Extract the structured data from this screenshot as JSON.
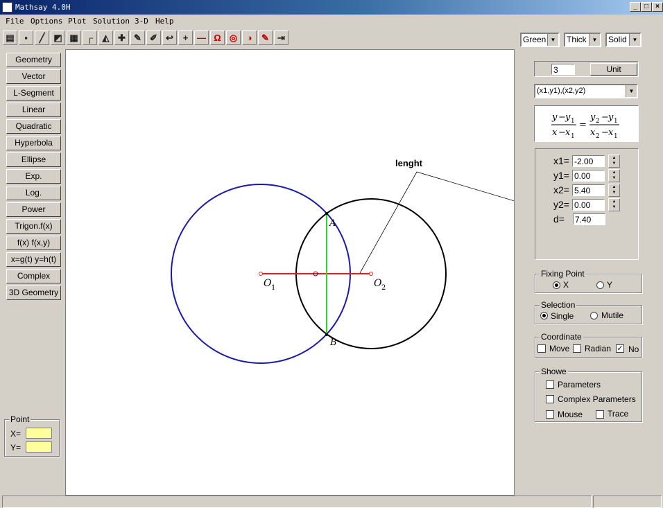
{
  "window": {
    "title": "Mathsay 4.0H",
    "minimize": "_",
    "maximize": "□",
    "close": "×"
  },
  "menu": [
    "File",
    "Options",
    "Plot",
    "Solution",
    "3-D",
    "Help"
  ],
  "toolbar": {
    "icons": [
      "print-icon",
      "save-icon",
      "pen-line-icon",
      "eraser-icon",
      "grid-icon",
      "axis-corner-icon",
      "triangle-icon",
      "crosshair-icon",
      "pencil-icon",
      "wand-icon",
      "undo-arrow-icon",
      "plus-icon",
      "minus-icon",
      "magnet-icon",
      "target-icon",
      "half-circle-icon",
      "red-pencil-icon",
      "exit-icon"
    ],
    "glyphs": [
      "▤",
      "▪",
      "╱",
      "◩",
      "▦",
      "┌",
      "◭",
      "✚",
      "✎",
      "✐",
      "↩",
      "+",
      "—",
      "Ω",
      "◎",
      "◑",
      "✎",
      "⇥"
    ],
    "color_select": "Green",
    "thickness_select": "Thick",
    "style_select": "Solid"
  },
  "left_buttons": [
    "Geometry",
    "Vector",
    "L-Segment",
    "Linear",
    "Quadratic",
    "Hyperbola",
    "Ellipse",
    "Exp.",
    "Log.",
    "Power",
    "Trigon.f(x)",
    "f(x)  f(x,y)",
    "x=g(t) y=h(t)",
    "Complex",
    "3D Geometry"
  ],
  "point": {
    "legend": "Point",
    "x_label": "X=",
    "y_label": "Y=",
    "x_value": "",
    "y_value": ""
  },
  "unit": {
    "value": "3",
    "button": "Unit"
  },
  "mode_select": "(x1,y1),(x2,y2)",
  "formula": {
    "y": "y",
    "y1": "y",
    "sub1": "1",
    "x": "x",
    "x1": "x",
    "y2": "y",
    "sub2": "2",
    "x2": "x",
    "minus": "−",
    "eq": "="
  },
  "params": [
    {
      "label": "x1=",
      "value": "-2.00"
    },
    {
      "label": "y1=",
      "value": "0.00"
    },
    {
      "label": "x2=",
      "value": "5.40"
    },
    {
      "label": "y2=",
      "value": "0.00"
    },
    {
      "label": "d=",
      "value": "7.40"
    }
  ],
  "fixing_point": {
    "legend": "Fixing Point",
    "options": [
      "X",
      "Y"
    ],
    "selected": "X"
  },
  "selection": {
    "legend": "Selection",
    "options": [
      "Single",
      "Mutile"
    ],
    "selected": "Single"
  },
  "coordinate": {
    "legend": "Coordinate",
    "items": [
      {
        "label": "Move",
        "checked": false
      },
      {
        "label": "Radian",
        "checked": false
      },
      {
        "label": "No",
        "checked": true
      }
    ]
  },
  "showe": {
    "legend": "Showe",
    "items": [
      {
        "label": "Parameters",
        "checked": false
      },
      {
        "label": "Complex Parameters",
        "checked": false
      },
      {
        "label": "Mouse",
        "checked": false
      },
      {
        "label": "Trace",
        "checked": false
      }
    ]
  },
  "figure": {
    "annotation": "lenght",
    "labels": {
      "o1": "O",
      "o1_sub": "1",
      "o2": "O",
      "o2_sub": "2",
      "a": "A",
      "b": "B"
    },
    "colors": {
      "circle1": "#1a1aa8",
      "circle2": "#000000",
      "segment": "#e02020",
      "chord": "#22dd22"
    }
  }
}
